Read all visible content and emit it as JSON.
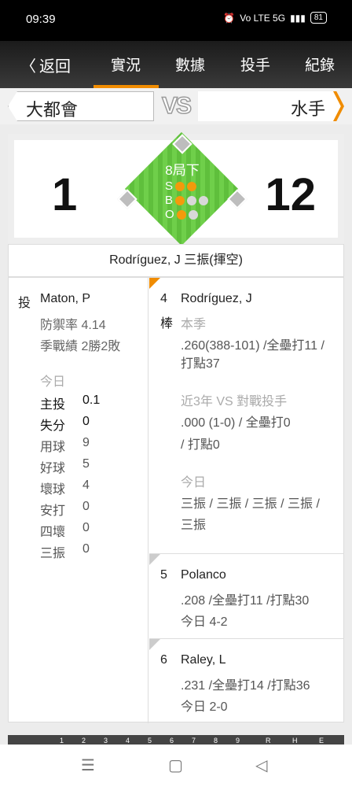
{
  "status": {
    "time": "09:39",
    "alarm_icon": "alarm-icon",
    "network": "Vo LTE 5G",
    "battery": "81"
  },
  "nav": {
    "back_label": "返回",
    "tabs": [
      "實況",
      "數據",
      "投手",
      "紀錄"
    ],
    "active_tab": "實況",
    "accent": "#f08c00"
  },
  "teams": {
    "home": "大都會",
    "away": "水手",
    "vs": "VS"
  },
  "score": {
    "home": "1",
    "away": "12"
  },
  "situation": {
    "inning": "8局下",
    "s_label": "S",
    "b_label": "B",
    "o_label": "O",
    "strikes": 2,
    "balls": 1,
    "outs": 2
  },
  "play_text": "Rodríguez, J 三振(揮空)",
  "pitcher": {
    "label": "投",
    "name": "Maton, P",
    "era_label": "防禦率",
    "era": "4.14",
    "season_label": "季戰績",
    "season": "2勝2敗",
    "today_label": "今日",
    "stats": [
      {
        "k": "主投",
        "v": "0.1"
      },
      {
        "k": "失分",
        "v": "0"
      },
      {
        "k": "用球",
        "v": "9"
      },
      {
        "k": "好球",
        "v": "5"
      },
      {
        "k": "壞球",
        "v": "4"
      },
      {
        "k": "安打",
        "v": "0"
      },
      {
        "k": "四壞",
        "v": "0"
      },
      {
        "k": "三振",
        "v": "0"
      }
    ]
  },
  "batters": [
    {
      "order": "4",
      "pos": "棒",
      "name": "Rodríguez, J",
      "season_label": "本季",
      "season_line1": ".260(388-101) /全壘打11 /",
      "season_line2": "打點37",
      "vs_label": "近3年 VS 對戰投手",
      "vs_line1": ".000 (1-0) / 全壘打0",
      "vs_line2": "/ 打點0",
      "today_label": "今日",
      "today_line1": "三振 / 三振 / 三振 / 三振 /",
      "today_line2": "三振"
    },
    {
      "order": "5",
      "name": "Polanco",
      "line1": ".208 /全壘打11 /打點30",
      "line2": "今日 4-2"
    },
    {
      "order": "6",
      "name": "Raley, L",
      "line1": ".231 /全壘打14 /打點36",
      "line2": "今日 2-0"
    }
  ],
  "strip_nums": [
    "1",
    "2",
    "3",
    "4",
    "5",
    "6",
    "7",
    "8",
    "9",
    "R",
    "H",
    "E"
  ]
}
